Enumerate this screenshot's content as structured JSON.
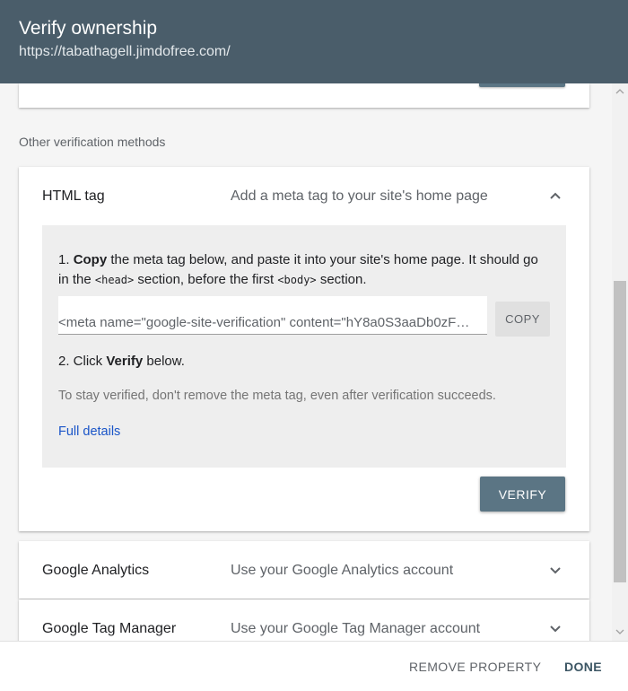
{
  "header": {
    "title": "Verify ownership",
    "url": "https://tabathagell.jimdofree.com/"
  },
  "section_label": "Other verification methods",
  "html_tag": {
    "title": "HTML tag",
    "description": "Add a meta tag to your site's home page",
    "step1_num": "1. ",
    "step1_bold": "Copy",
    "step1_text_a": " the meta tag below, and paste it into your site's home page. It should go in the ",
    "step1_code_head": "<head>",
    "step1_text_b": " section, before the first ",
    "step1_code_body": "<body>",
    "step1_text_c": " section.",
    "meta_tag": "<meta name=\"google-site-verification\" content=\"hY8a0S3aaDb0zF…",
    "copy_label": "COPY",
    "step2_prefix": "2. Click ",
    "step2_bold": "Verify",
    "step2_suffix": " below.",
    "stay_verified": "To stay verified, don't remove the meta tag, even after verification succeeds.",
    "full_details": "Full details",
    "verify_label": "VERIFY"
  },
  "google_analytics": {
    "title": "Google Analytics",
    "description": "Use your Google Analytics account"
  },
  "google_tag_manager": {
    "title": "Google Tag Manager",
    "description": "Use your Google Tag Manager account"
  },
  "footer": {
    "remove_label": "REMOVE PROPERTY",
    "done_label": "DONE"
  },
  "colors": {
    "header_bg": "#4a5d6a",
    "primary_button": "#5b7584",
    "link": "#1a55c8"
  }
}
